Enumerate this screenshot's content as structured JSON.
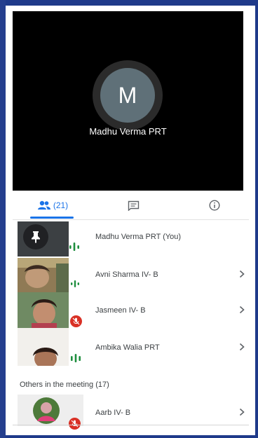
{
  "stage": {
    "avatar_letter": "M",
    "name": "Madhu Verma PRT"
  },
  "tabs": {
    "people_label": "(21)"
  },
  "participants": [
    {
      "name": "Madhu Verma PRT (You)",
      "mic": "speaking"
    },
    {
      "name": "Avni Sharma IV- B",
      "mic": "speaking"
    },
    {
      "name": "Jasmeen IV- B",
      "mic": "muted"
    },
    {
      "name": "Ambika Walia PRT",
      "mic": "speaking"
    }
  ],
  "others": {
    "title": "Others in the meeting (17)",
    "items": [
      {
        "name": "Aarb IV- B",
        "mic": "muted"
      }
    ]
  },
  "colors": {
    "accent": "#1a73e8",
    "speaking": "#1e8e3e",
    "muted": "#d93025"
  }
}
